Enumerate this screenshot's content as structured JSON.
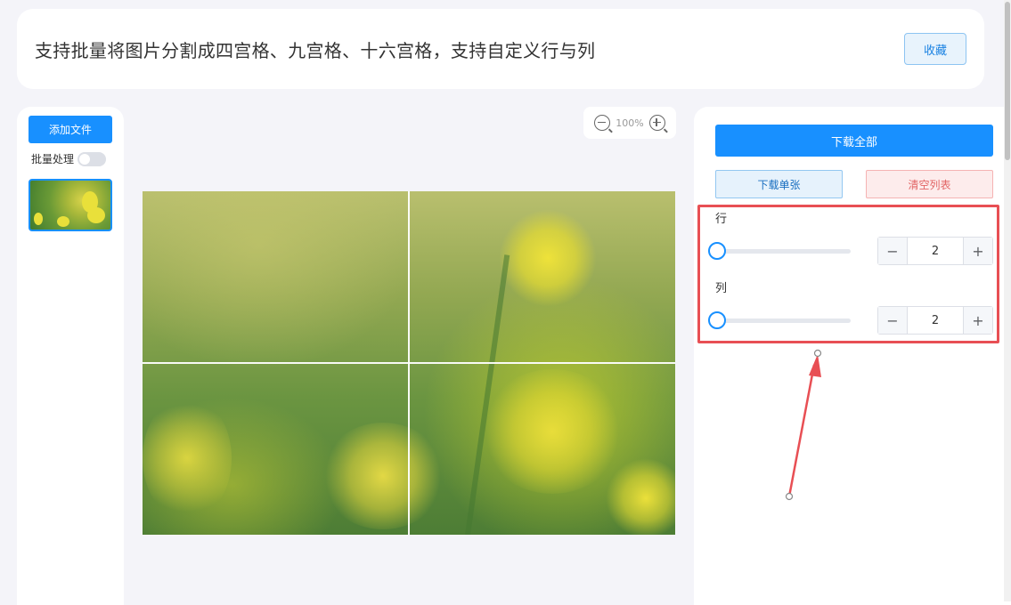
{
  "header": {
    "title": "支持批量将图片分割成四宫格、九宫格、十六宫格，支持自定义行与列",
    "favorite_label": "收藏"
  },
  "left_panel": {
    "add_file_label": "添加文件",
    "batch_label": "批量处理",
    "batch_enabled": false
  },
  "zoom": {
    "level": "100%",
    "zoom_out_icon": "zoom-out-icon",
    "zoom_in_icon": "zoom-in-icon"
  },
  "preview": {
    "grid_rows": 2,
    "grid_cols": 2
  },
  "right_panel": {
    "download_all_label": "下载全部",
    "download_single_label": "下载单张",
    "clear_list_label": "清空列表",
    "rows": {
      "label": "行",
      "value": "2",
      "minus": "−",
      "plus": "+",
      "slider_fraction": 0
    },
    "cols": {
      "label": "列",
      "value": "2",
      "minus": "−",
      "plus": "+",
      "slider_fraction": 0
    }
  },
  "colors": {
    "accent": "#1890ff",
    "highlight_box": "#e84f54",
    "danger_text": "#e26464"
  }
}
